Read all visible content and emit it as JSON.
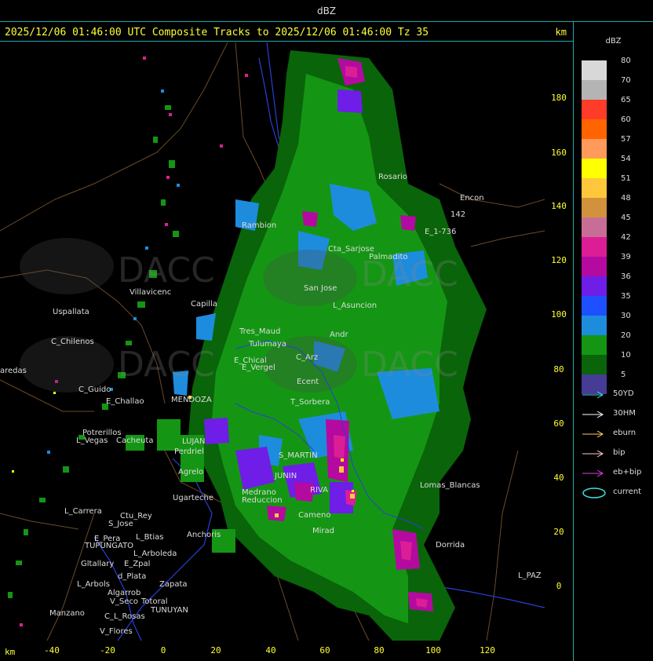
{
  "window": {
    "title": "dBZ"
  },
  "header": {
    "caption": "2025/12/06 01:46:00 UTC Composite Tracks to 2025/12/06 01:46:00 Tz 35",
    "unit": "km"
  },
  "axes": {
    "x_unit": "km",
    "x_ticks": [
      "-40",
      "-20",
      "0",
      "20",
      "40",
      "60",
      "80",
      "100",
      "120"
    ],
    "y_ticks": [
      "180",
      "160",
      "140",
      "120",
      "100",
      "80",
      "60",
      "40",
      "20",
      "0"
    ]
  },
  "legend": {
    "title": "dBZ",
    "levels": [
      {
        "label": "80",
        "color": "#d8d8d8"
      },
      {
        "label": "70",
        "color": "#b4b4b4"
      },
      {
        "label": "65",
        "color": "#ff3c28"
      },
      {
        "label": "60",
        "color": "#ff6400"
      },
      {
        "label": "57",
        "color": "#ff9a5a"
      },
      {
        "label": "54",
        "color": "#ffff00"
      },
      {
        "label": "51",
        "color": "#ffc83c"
      },
      {
        "label": "48",
        "color": "#d2913c"
      },
      {
        "label": "45",
        "color": "#c86e96"
      },
      {
        "label": "42",
        "color": "#dc1e96"
      },
      {
        "label": "39",
        "color": "#b40aa0"
      },
      {
        "label": "36",
        "color": "#6e1ee6"
      },
      {
        "label": "35",
        "color": "#1e50ff"
      },
      {
        "label": "30",
        "color": "#1e8cdc"
      },
      {
        "label": "20",
        "color": "#149614"
      },
      {
        "label": "10",
        "color": "#0a640a"
      },
      {
        "label": "5",
        "color": "#463c96"
      }
    ],
    "tracks": [
      {
        "label": "50YD",
        "color": "#40e0e0"
      },
      {
        "label": "30HM",
        "color": "#ffffff"
      },
      {
        "label": "eburn",
        "color": "#ffcc66"
      },
      {
        "label": "bip",
        "color": "#ffcccc"
      },
      {
        "label": "eb+bip",
        "color": "#e040e0"
      }
    ],
    "current": {
      "label": "current",
      "color": "#40e0e0"
    }
  },
  "places": [
    "Uspallata",
    "C_Chilenos",
    "aredas",
    "C_Guido",
    "E_Challao",
    "Potrerillos",
    "L_Vegas",
    "Cacheuta",
    "Perdriel",
    "Agrelo",
    "Ugarteche",
    "L_Carrera",
    "Ctu_Rey",
    "S_Jose",
    "E_Pera",
    "L_Btias",
    "Anchoris",
    "TUPUNGATO",
    "L_Arboleda",
    "Gltallary",
    "E_Zpal",
    "d_Plata",
    "L_Arbols",
    "Zapata",
    "Algarrob",
    "V_Seco",
    "Totoral",
    "TUNUYAN",
    "Manzano",
    "C_L_Rosas",
    "V_Flores",
    "Villavicenc",
    "Capilla",
    "Rambion",
    "San Jose",
    "Cta_Sarjose",
    "Palmadito",
    "L_Asuncion",
    "Tres_Maud",
    "Tulumaya",
    "Andr",
    "C_Arz",
    "E_Chical",
    "E_Vergel",
    "Ecent",
    "T_Sorbera",
    "MENDOZA",
    "LUJAN",
    "S_MARTIN",
    "JUNIN",
    "RIVA",
    "Medrano",
    "Reduccion",
    "Cameno",
    "Mirad",
    "Lomas_Blancas",
    "Dorrida",
    "L_PAZ",
    "Rosario",
    "Encon",
    "E_1-736",
    "142"
  ]
}
